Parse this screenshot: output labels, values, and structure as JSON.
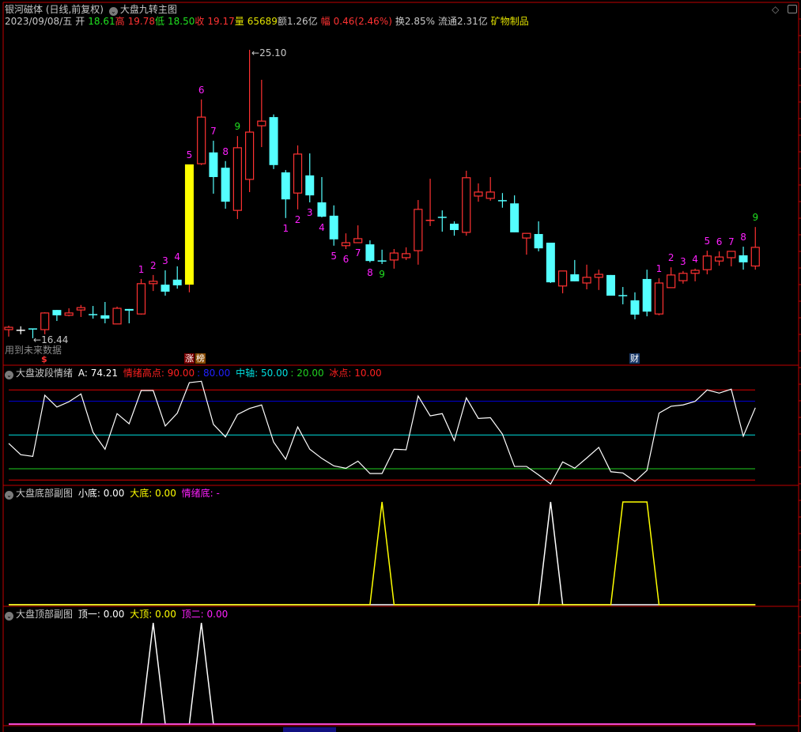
{
  "header": {
    "title": "银河磁体 (日线,前复权)",
    "indicator": "大盘九转主图",
    "info": [
      {
        "label": "2023/09/08/五",
        "color": "#c8c8c8"
      },
      {
        "label": "开",
        "color": "#c8c8c8"
      },
      {
        "label": "18.61",
        "color": "#20e020"
      },
      {
        "label": "高",
        "color": "#ff3232"
      },
      {
        "label": "19.78",
        "color": "#ff3232"
      },
      {
        "label": "低",
        "color": "#20e020"
      },
      {
        "label": "18.50",
        "color": "#20e020"
      },
      {
        "label": "收",
        "color": "#ff3232"
      },
      {
        "label": "19.17",
        "color": "#ff3232"
      },
      {
        "label": "量",
        "color": "#e0e000"
      },
      {
        "label": "65689",
        "color": "#e0e000"
      },
      {
        "label": "额1.26亿",
        "color": "#c8c8c8"
      },
      {
        "label": "幅",
        "color": "#ff3232"
      },
      {
        "label": "0.46(2.46%)",
        "color": "#ff3232"
      },
      {
        "label": "换2.85%",
        "color": "#c8c8c8"
      },
      {
        "label": "流通2.31亿",
        "color": "#c8c8c8"
      },
      {
        "label": "矿物制品",
        "color": "#e0e000"
      }
    ]
  },
  "main_notes": {
    "future_data": "用到未来数据",
    "high_marker": "25.10",
    "low_marker": "16.44",
    "dollar_tag": "$",
    "tag_zhang": "涨",
    "tag_bang": "榜",
    "tag_cai": "财"
  },
  "panels": {
    "emotion": {
      "title": "大盘波段情绪",
      "a_label": "A: 74.21",
      "high_label": "情绪高点: 90.00",
      "eighty_label": ": 80.00",
      "mid_label": "中轴: 50.00",
      "twenty_label": ": 20.00",
      "ice_label": "冰点: 10.00"
    },
    "bottom": {
      "title": "大盘底部副图",
      "small_label": "小底: 0.00",
      "big_label": "大底: 0.00",
      "emotion_label": "情绪底: -"
    },
    "top": {
      "title": "大盘顶部副图",
      "one_label": "顶一: 0.00",
      "big_label": "大顶: 0.00",
      "two_label": "顶二: 0.00"
    }
  },
  "colors": {
    "up": "#ff3232",
    "down": "#54ffff",
    "limit": "#ffff00",
    "magenta": "#ff20ff",
    "green": "#20e020",
    "grid_red": "#c00000"
  },
  "chart_data": [
    {
      "type": "candlestick",
      "title": "大盘九转主图",
      "ylim": [
        16.44,
        25.1
      ],
      "fields": [
        "open",
        "high",
        "low",
        "close"
      ],
      "white_index": 1,
      "limit_up_index": 15,
      "high_index": 20,
      "low_index": 2,
      "candles": [
        [
          16.7,
          16.82,
          16.49,
          16.77
        ],
        [
          16.68,
          16.8,
          16.56,
          16.68
        ],
        [
          16.72,
          16.72,
          16.44,
          16.71
        ],
        [
          16.7,
          17.22,
          16.56,
          17.2
        ],
        [
          17.29,
          17.29,
          16.96,
          17.13
        ],
        [
          17.13,
          17.34,
          17.1,
          17.2
        ],
        [
          17.29,
          17.44,
          17.08,
          17.36
        ],
        [
          17.15,
          17.41,
          17.03,
          17.14
        ],
        [
          17.13,
          17.53,
          16.89,
          17.03
        ],
        [
          16.87,
          17.39,
          16.87,
          17.34
        ],
        [
          17.32,
          17.32,
          16.89,
          17.27
        ],
        [
          17.17,
          18.22,
          17.15,
          18.08
        ],
        [
          18.08,
          18.34,
          17.86,
          18.15
        ],
        [
          18.05,
          18.48,
          17.72,
          17.84
        ],
        [
          18.2,
          18.6,
          17.93,
          18.03
        ],
        [
          18.05,
          21.66,
          17.82,
          21.66
        ],
        [
          21.68,
          23.61,
          21.64,
          23.08
        ],
        [
          22.02,
          22.37,
          20.78,
          21.28
        ],
        [
          21.56,
          21.76,
          20.33,
          20.54
        ],
        [
          20.28,
          22.51,
          20.02,
          22.16
        ],
        [
          21.21,
          25.1,
          20.83,
          22.63
        ],
        [
          22.82,
          24.2,
          22.18,
          22.96
        ],
        [
          23.08,
          23.16,
          21.52,
          21.64
        ],
        [
          21.42,
          21.49,
          20.05,
          20.61
        ],
        [
          20.8,
          22.23,
          20.31,
          21.97
        ],
        [
          21.33,
          21.99,
          20.52,
          20.73
        ],
        [
          20.52,
          21.28,
          20.07,
          20.09
        ],
        [
          20.12,
          20.43,
          19.22,
          19.41
        ],
        [
          19.22,
          19.59,
          19.12,
          19.31
        ],
        [
          19.31,
          19.83,
          19.31,
          19.43
        ],
        [
          19.26,
          19.38,
          18.72,
          18.76
        ],
        [
          18.76,
          19.1,
          18.67,
          18.75
        ],
        [
          18.79,
          19.12,
          18.53,
          19.0
        ],
        [
          18.86,
          19.17,
          18.79,
          18.98
        ],
        [
          19.07,
          20.59,
          18.65,
          20.31
        ],
        [
          19.97,
          21.23,
          19.81,
          19.98
        ],
        [
          20.07,
          20.28,
          19.64,
          20.06
        ],
        [
          19.88,
          19.95,
          19.52,
          19.69
        ],
        [
          19.62,
          21.47,
          19.52,
          21.26
        ],
        [
          20.71,
          21.09,
          20.54,
          20.83
        ],
        [
          20.64,
          21.28,
          20.57,
          20.83
        ],
        [
          20.57,
          20.8,
          20.36,
          20.56
        ],
        [
          20.49,
          20.73,
          19.62,
          19.62
        ],
        [
          19.45,
          19.59,
          18.95,
          19.59
        ],
        [
          19.57,
          19.95,
          19.05,
          19.14
        ],
        [
          19.31,
          19.31,
          18.1,
          18.12
        ],
        [
          18.01,
          18.46,
          17.79,
          18.46
        ],
        [
          18.36,
          18.79,
          18.15,
          18.15
        ],
        [
          18.1,
          18.65,
          17.91,
          18.27
        ],
        [
          18.27,
          18.5,
          17.89,
          18.36
        ],
        [
          18.34,
          18.34,
          17.72,
          17.72
        ],
        [
          17.72,
          17.98,
          17.46,
          17.71
        ],
        [
          17.58,
          17.82,
          17.01,
          17.15
        ],
        [
          18.22,
          18.5,
          17.1,
          17.24
        ],
        [
          17.17,
          18.24,
          17.13,
          18.1
        ],
        [
          17.96,
          18.57,
          17.96,
          18.34
        ],
        [
          18.17,
          18.46,
          18.08,
          18.39
        ],
        [
          18.39,
          18.53,
          18.15,
          18.48
        ],
        [
          18.5,
          19.07,
          18.36,
          18.91
        ],
        [
          18.76,
          19.05,
          18.62,
          18.88
        ],
        [
          18.86,
          19.05,
          18.6,
          19.05
        ],
        [
          18.93,
          19.19,
          18.5,
          18.72
        ],
        [
          18.61,
          19.78,
          18.5,
          19.17
        ]
      ],
      "nine_turn_labels": [
        {
          "i": 11,
          "t": "1",
          "c": "magenta",
          "pos": "above"
        },
        {
          "i": 12,
          "t": "2",
          "c": "magenta",
          "pos": "above"
        },
        {
          "i": 13,
          "t": "3",
          "c": "magenta",
          "pos": "above"
        },
        {
          "i": 14,
          "t": "4",
          "c": "magenta",
          "pos": "above"
        },
        {
          "i": 15,
          "t": "5",
          "c": "magenta",
          "pos": "above"
        },
        {
          "i": 16,
          "t": "6",
          "c": "magenta",
          "pos": "above"
        },
        {
          "i": 17,
          "t": "7",
          "c": "magenta",
          "pos": "above"
        },
        {
          "i": 18,
          "t": "8",
          "c": "magenta",
          "pos": "above"
        },
        {
          "i": 19,
          "t": "9",
          "c": "green",
          "pos": "above"
        },
        {
          "i": 23,
          "t": "1",
          "c": "magenta",
          "pos": "below"
        },
        {
          "i": 24,
          "t": "2",
          "c": "magenta",
          "pos": "below"
        },
        {
          "i": 25,
          "t": "3",
          "c": "magenta",
          "pos": "below"
        },
        {
          "i": 26,
          "t": "4",
          "c": "magenta",
          "pos": "below"
        },
        {
          "i": 27,
          "t": "5",
          "c": "magenta",
          "pos": "below"
        },
        {
          "i": 28,
          "t": "6",
          "c": "magenta",
          "pos": "below"
        },
        {
          "i": 29,
          "t": "7",
          "c": "magenta",
          "pos": "below"
        },
        {
          "i": 30,
          "t": "8",
          "c": "magenta",
          "pos": "below"
        },
        {
          "i": 31,
          "t": "9",
          "c": "green",
          "pos": "below"
        },
        {
          "i": 54,
          "t": "1",
          "c": "magenta",
          "pos": "above"
        },
        {
          "i": 55,
          "t": "2",
          "c": "magenta",
          "pos": "above"
        },
        {
          "i": 56,
          "t": "3",
          "c": "magenta",
          "pos": "above"
        },
        {
          "i": 57,
          "t": "4",
          "c": "magenta",
          "pos": "above"
        },
        {
          "i": 58,
          "t": "5",
          "c": "magenta",
          "pos": "above"
        },
        {
          "i": 59,
          "t": "6",
          "c": "magenta",
          "pos": "above"
        },
        {
          "i": 60,
          "t": "7",
          "c": "magenta",
          "pos": "above"
        },
        {
          "i": 61,
          "t": "8",
          "c": "magenta",
          "pos": "above"
        },
        {
          "i": 62,
          "t": "9",
          "c": "green",
          "pos": "above"
        }
      ]
    },
    {
      "type": "line",
      "title": "大盘波段情绪",
      "ylim": [
        0,
        100
      ],
      "reference_lines": [
        {
          "value": 90,
          "color": "#e00000"
        },
        {
          "value": 80,
          "color": "#0000d0"
        },
        {
          "value": 50,
          "color": "#00e0e0"
        },
        {
          "value": 20,
          "color": "#20d020"
        },
        {
          "value": 10,
          "color": "#e00000"
        }
      ],
      "series": [
        {
          "name": "A",
          "color": "#ffffff",
          "values": [
            42.5,
            32.5,
            31,
            85.3,
            74.8,
            79.5,
            86.5,
            52.5,
            37.4,
            69,
            60,
            89.5,
            89.5,
            58,
            69.4,
            96.5,
            97.7,
            59.5,
            48.3,
            68.2,
            73.6,
            76.7,
            43.7,
            28.5,
            57.2,
            37.4,
            29.2,
            22.6,
            20.5,
            26.8,
            15.8,
            15.8,
            37.4,
            36.9,
            84.6,
            67,
            69,
            45.1,
            83,
            64.7,
            65.4,
            50.7,
            22.1,
            22.1,
            14.6,
            6.5,
            26.1,
            20.5,
            29.6,
            39,
            17.4,
            16.3,
            8.8,
            18.6,
            69.4,
            75.5,
            76.7,
            79.9,
            90,
            87.2,
            90.7,
            49,
            74.21
          ]
        }
      ]
    },
    {
      "type": "line",
      "title": "大盘底部副图",
      "ylim": [
        0,
        1
      ],
      "series": [
        {
          "name": "小底",
          "color": "#ffffff",
          "spikes": [
            45
          ]
        },
        {
          "name": "大底",
          "color": "#ffff00",
          "spikes": [
            31,
            51,
            52,
            53
          ]
        }
      ]
    },
    {
      "type": "line",
      "title": "大盘顶部副图",
      "ylim": [
        0,
        1
      ],
      "series": [
        {
          "name": "顶一",
          "color": "#ffffff",
          "spikes": [
            12,
            16
          ]
        },
        {
          "name": "大顶",
          "color": "#ffff00",
          "spikes": []
        },
        {
          "name": "顶二",
          "color": "#ff20ff",
          "spikes": []
        }
      ]
    }
  ]
}
